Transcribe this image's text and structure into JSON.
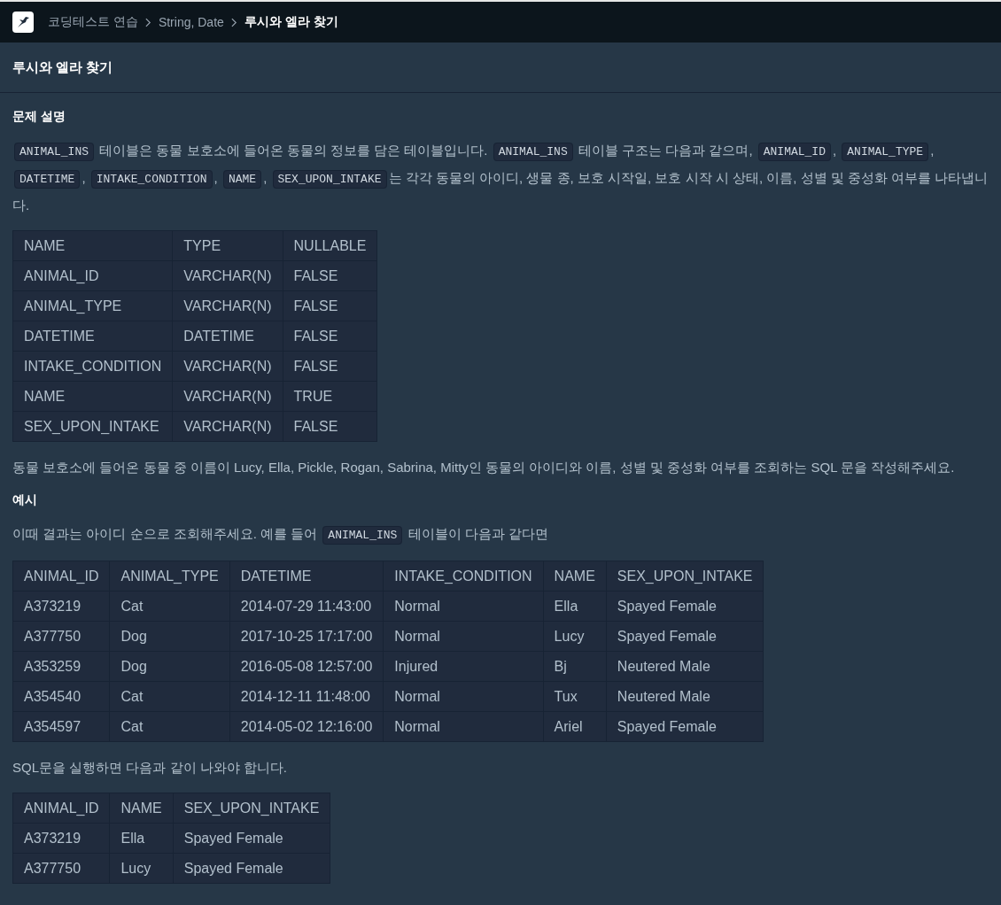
{
  "breadcrumbs": [
    {
      "text": "코딩테스트 연습",
      "current": false
    },
    {
      "text": "String, Date",
      "current": false
    },
    {
      "text": "루시와 엘라 찾기",
      "current": true
    }
  ],
  "title": "루시와 엘라 찾기",
  "sections": [
    {
      "heading": "문제 설명",
      "blocks": [
        {
          "kind": "paragraph",
          "parts": [
            {
              "kind": "code",
              "text": "ANIMAL_INS"
            },
            {
              "kind": "text",
              "text": " 테이블은 동물 보호소에 들어온 동물의 정보를 담은 테이블입니다. "
            },
            {
              "kind": "code",
              "text": "ANIMAL_INS"
            },
            {
              "kind": "text",
              "text": " 테이블 구조는 다음과 같으며, "
            },
            {
              "kind": "code",
              "text": "ANIMAL_ID"
            },
            {
              "kind": "text",
              "text": ", "
            },
            {
              "kind": "code",
              "text": "ANIMAL_TYPE"
            },
            {
              "kind": "text",
              "text": ", "
            },
            {
              "kind": "code",
              "text": "DATETIME"
            },
            {
              "kind": "text",
              "text": ", "
            },
            {
              "kind": "code",
              "text": "INTAKE_CONDITION"
            },
            {
              "kind": "text",
              "text": ", "
            },
            {
              "kind": "code",
              "text": "NAME"
            },
            {
              "kind": "text",
              "text": ", "
            },
            {
              "kind": "code",
              "text": "SEX_UPON_INTAKE"
            },
            {
              "kind": "text",
              "text": "는 각각 동물의 아이디, 생물 종, 보호 시작일, 보호 시작 시 상태, 이름, 성별 및 중성화 여부를 나타냅니다."
            }
          ]
        },
        {
          "kind": "table",
          "columns": [
            "NAME",
            "TYPE",
            "NULLABLE"
          ],
          "rows": [
            [
              "ANIMAL_ID",
              "VARCHAR(N)",
              "FALSE"
            ],
            [
              "ANIMAL_TYPE",
              "VARCHAR(N)",
              "FALSE"
            ],
            [
              "DATETIME",
              "DATETIME",
              "FALSE"
            ],
            [
              "INTAKE_CONDITION",
              "VARCHAR(N)",
              "FALSE"
            ],
            [
              "NAME",
              "VARCHAR(N)",
              "TRUE"
            ],
            [
              "SEX_UPON_INTAKE",
              "VARCHAR(N)",
              "FALSE"
            ]
          ]
        },
        {
          "kind": "paragraph",
          "parts": [
            {
              "kind": "text",
              "text": "동물 보호소에 들어온 동물 중 이름이 Lucy, Ella, Pickle, Rogan, Sabrina, Mitty인 동물의 아이디와 이름, 성별 및 중성화 여부를 조회하는 SQL 문을 작성해주세요."
            }
          ]
        }
      ]
    },
    {
      "heading": "예시",
      "blocks": [
        {
          "kind": "paragraph",
          "parts": [
            {
              "kind": "text",
              "text": "이때 결과는 아이디 순으로 조회해주세요. 예를 들어 "
            },
            {
              "kind": "code",
              "text": "ANIMAL_INS"
            },
            {
              "kind": "text",
              "text": " 테이블이 다음과 같다면"
            }
          ]
        },
        {
          "kind": "table",
          "columns": [
            "ANIMAL_ID",
            "ANIMAL_TYPE",
            "DATETIME",
            "INTAKE_CONDITION",
            "NAME",
            "SEX_UPON_INTAKE"
          ],
          "rows": [
            [
              "A373219",
              "Cat",
              "2014-07-29 11:43:00",
              "Normal",
              "Ella",
              "Spayed Female"
            ],
            [
              "A377750",
              "Dog",
              "2017-10-25 17:17:00",
              "Normal",
              "Lucy",
              "Spayed Female"
            ],
            [
              "A353259",
              "Dog",
              "2016-05-08 12:57:00",
              "Injured",
              "Bj",
              "Neutered Male"
            ],
            [
              "A354540",
              "Cat",
              "2014-12-11 11:48:00",
              "Normal",
              "Tux",
              "Neutered Male"
            ],
            [
              "A354597",
              "Cat",
              "2014-05-02 12:16:00",
              "Normal",
              "Ariel",
              "Spayed Female"
            ]
          ]
        },
        {
          "kind": "paragraph",
          "parts": [
            {
              "kind": "text",
              "text": "SQL문을 실행하면 다음과 같이 나와야 합니다."
            }
          ]
        },
        {
          "kind": "table",
          "columns": [
            "ANIMAL_ID",
            "NAME",
            "SEX_UPON_INTAKE"
          ],
          "rows": [
            [
              "A373219",
              "Ella",
              "Spayed Female"
            ],
            [
              "A377750",
              "Lucy",
              "Spayed Female"
            ]
          ]
        }
      ]
    }
  ]
}
